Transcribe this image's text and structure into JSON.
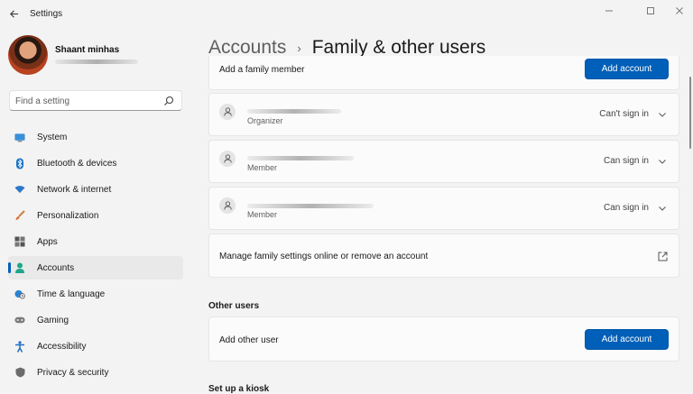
{
  "window": {
    "title": "Settings",
    "back_icon": "back-arrow-icon",
    "controls": [
      "minimize-icon",
      "maximize-icon",
      "close-icon"
    ]
  },
  "profile": {
    "name": "Shaant minhas",
    "email_redacted": true
  },
  "search": {
    "placeholder": "Find a setting",
    "value": ""
  },
  "sidebar": {
    "items": [
      {
        "label": "System",
        "icon": "system-display-icon",
        "active": false
      },
      {
        "label": "Bluetooth & devices",
        "icon": "bluetooth-icon",
        "active": false
      },
      {
        "label": "Network & internet",
        "icon": "wifi-icon",
        "active": false
      },
      {
        "label": "Personalization",
        "icon": "paint-brush-icon",
        "active": false
      },
      {
        "label": "Apps",
        "icon": "apps-grid-icon",
        "active": false
      },
      {
        "label": "Accounts",
        "icon": "person-icon",
        "active": true
      },
      {
        "label": "Time & language",
        "icon": "globe-clock-icon",
        "active": false
      },
      {
        "label": "Gaming",
        "icon": "gamepad-icon",
        "active": false
      },
      {
        "label": "Accessibility",
        "icon": "accessibility-icon",
        "active": false
      },
      {
        "label": "Privacy & security",
        "icon": "shield-icon",
        "active": false
      }
    ]
  },
  "header": {
    "parent": "Accounts",
    "separator": "›",
    "current": "Family & other users"
  },
  "family": {
    "add_member_label": "Add a family member",
    "add_account_button": "Add account",
    "members": [
      {
        "role": "Organizer",
        "status": "Can't sign in"
      },
      {
        "role": "Member",
        "status": "Can sign in"
      },
      {
        "role": "Member",
        "status": "Can sign in"
      }
    ],
    "manage_label": "Manage family settings online or remove an account",
    "manage_icon": "external-link-icon"
  },
  "other_users": {
    "heading": "Other users",
    "add_other_label": "Add other user",
    "add_account_button": "Add account"
  },
  "kiosk": {
    "heading": "Set up a kiosk"
  },
  "colors": {
    "accent": "#005fb8",
    "background": "#f3f3f3",
    "card": "#fbfbfb"
  }
}
